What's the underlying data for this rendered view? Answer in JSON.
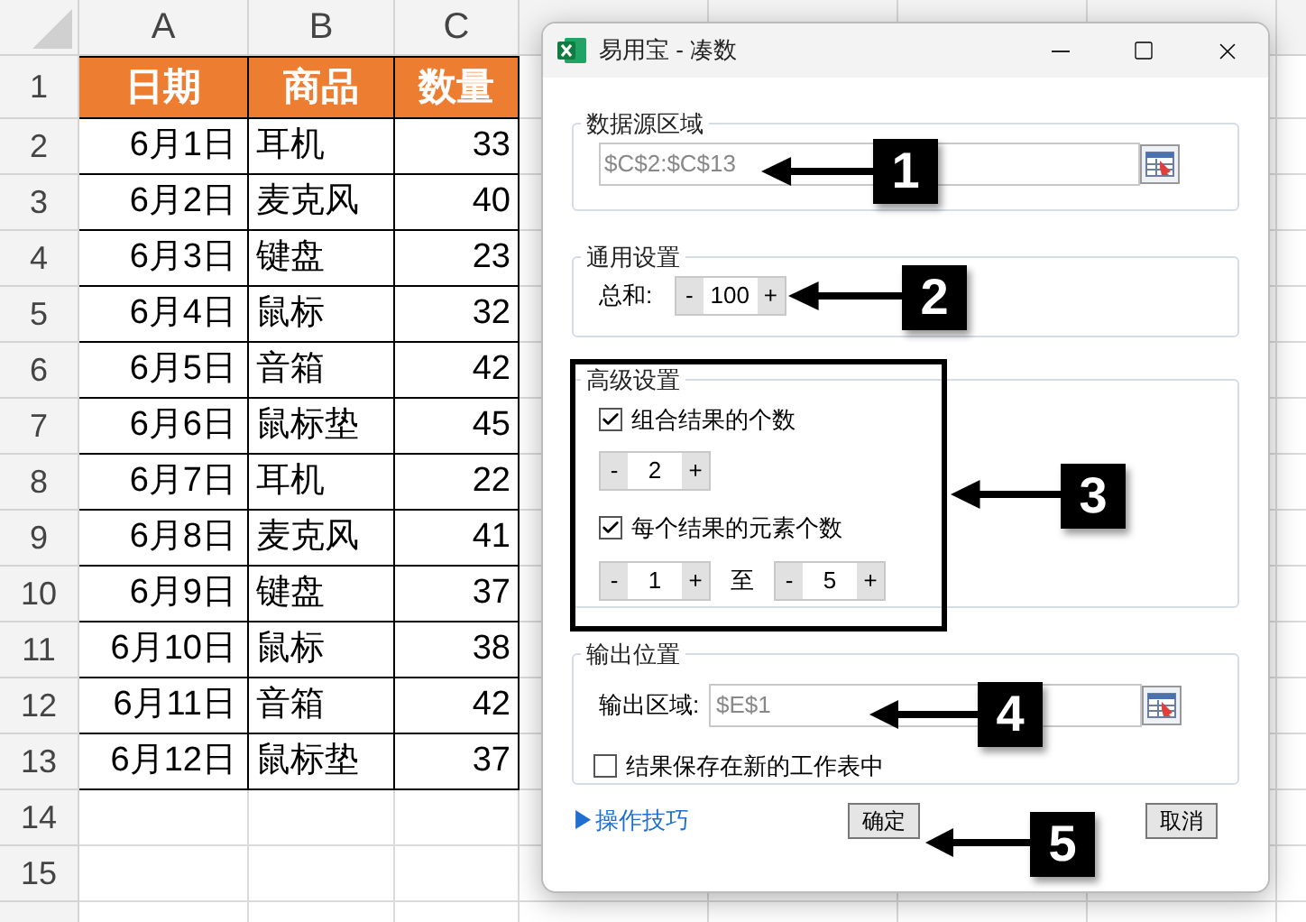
{
  "spreadsheet": {
    "columns": [
      "A",
      "B",
      "C"
    ],
    "header_row": "1",
    "header": [
      "日期",
      "商品",
      "数量"
    ],
    "rows": [
      {
        "row": "2",
        "date": "6月1日",
        "product": "耳机",
        "qty": "33"
      },
      {
        "row": "3",
        "date": "6月2日",
        "product": "麦克风",
        "qty": "40"
      },
      {
        "row": "4",
        "date": "6月3日",
        "product": "键盘",
        "qty": "23"
      },
      {
        "row": "5",
        "date": "6月4日",
        "product": "鼠标",
        "qty": "32"
      },
      {
        "row": "6",
        "date": "6月5日",
        "product": "音箱",
        "qty": "42"
      },
      {
        "row": "7",
        "date": "6月6日",
        "product": "鼠标垫",
        "qty": "45"
      },
      {
        "row": "8",
        "date": "6月7日",
        "product": "耳机",
        "qty": "22"
      },
      {
        "row": "9",
        "date": "6月8日",
        "product": "麦克风",
        "qty": "41"
      },
      {
        "row": "10",
        "date": "6月9日",
        "product": "键盘",
        "qty": "37"
      },
      {
        "row": "11",
        "date": "6月10日",
        "product": "鼠标",
        "qty": "38"
      },
      {
        "row": "12",
        "date": "6月11日",
        "product": "音箱",
        "qty": "42"
      },
      {
        "row": "13",
        "date": "6月12日",
        "product": "鼠标垫",
        "qty": "37"
      }
    ],
    "empty_rows": [
      "14",
      "15"
    ]
  },
  "dialog": {
    "title": "易用宝 - 凑数",
    "source": {
      "legend": "数据源区域",
      "value": "$C$2:$C$13"
    },
    "general": {
      "legend": "通用设置",
      "label": "总和:",
      "spinner": {
        "minus": "-",
        "value": "100",
        "plus": "+"
      }
    },
    "advanced": {
      "legend": "高级设置",
      "count_check": {
        "label": "组合结果的个数",
        "checked": true
      },
      "count_spinner": {
        "minus": "-",
        "value": "2",
        "plus": "+"
      },
      "size_check": {
        "label": "每个结果的元素个数",
        "checked": true
      },
      "size_min": {
        "minus": "-",
        "value": "1",
        "plus": "+"
      },
      "to": "至",
      "size_max": {
        "minus": "-",
        "value": "5",
        "plus": "+"
      }
    },
    "output": {
      "legend": "输出位置",
      "label": "输出区域:",
      "value": "$E$1",
      "new_sheet": {
        "label": "结果保存在新的工作表中",
        "checked": false
      }
    },
    "tips_link": "▶操作技巧",
    "ok": "确定",
    "cancel": "取消"
  },
  "annotations": [
    {
      "label": "1"
    },
    {
      "label": "2"
    },
    {
      "label": "3"
    },
    {
      "label": "4"
    },
    {
      "label": "5"
    }
  ]
}
